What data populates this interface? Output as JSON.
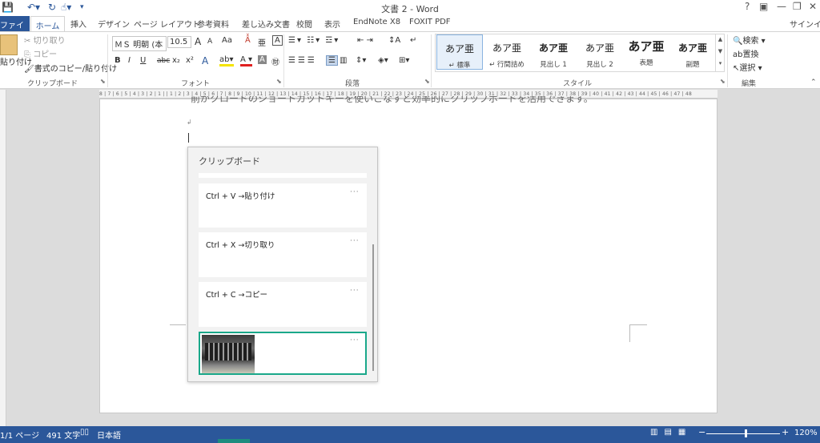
{
  "app": {
    "title": "文書 2 - Word",
    "help": "?",
    "signin": "サインイン"
  },
  "tabs": {
    "file": "ファイル",
    "home": "ホーム",
    "insert": "挿入",
    "design": "デザイン",
    "layout": "ページ レイアウト",
    "references": "参考資料",
    "mailings": "差し込み文書",
    "review": "校閲",
    "view": "表示",
    "endnote": "EndNote X8",
    "foxit": "FOXIT PDF"
  },
  "ribbon": {
    "clipboard": {
      "paste": "貼り付け",
      "cut": "切り取り",
      "copy": "コピー",
      "format_painter": "書式のコピー/貼り付け",
      "label": "クリップボード"
    },
    "font": {
      "name": "ＭＳ 明朝 (本",
      "size": "10.5",
      "grow": "A",
      "shrink": "A",
      "case": "Aa",
      "label": "フォント",
      "bold": "B",
      "italic": "I",
      "underline": "U",
      "strike": "abc",
      "sub": "x₂",
      "sup": "x²"
    },
    "paragraph": {
      "label": "段落"
    },
    "styles": {
      "label": "スタイル",
      "items": [
        {
          "preview": "あア亜",
          "name": "↵ 標準"
        },
        {
          "preview": "あア亜",
          "name": "↵ 行間詰め"
        },
        {
          "preview": "あア亜",
          "name": "見出し 1"
        },
        {
          "preview": "あア亜",
          "name": "見出し 2"
        },
        {
          "preview": "あア亜",
          "name": "表題"
        },
        {
          "preview": "あア亜",
          "name": "副題"
        }
      ]
    },
    "editing": {
      "find": "検索",
      "replace": "置換",
      "select": "選択",
      "label": "編集"
    }
  },
  "ruler": {
    "ticks": "8 | 7 | 6 | 5 | 4 | 3 | 2 | 1 |   | 1 | 2 | 3 | 4 | 5 | 6 | 7 | 8 | 9 | 10 | 11 | 12 | 13 | 14 | 15 | 16 | 17 | 18 | 19 | 20 | 21 | 22 | 23 | 24 | 25 | 26 | 27 | 28 | 29 | 30 | 31 | 32 | 33 | 34 | 35 | 36 | 37 | 38 | 39 | 40 | 41 | 42 | 43 | 44 | 45 | 46 | 47 | 48"
  },
  "document": {
    "partial_line": "前がクロードのショートカットキーを使いこなすと効率的にクリップボードを活用できます。"
  },
  "clipboard_panel": {
    "title": "クリップボード",
    "more": "···",
    "items": [
      {
        "text": "Ctrl + V →貼り付け"
      },
      {
        "text": "Ctrl + X →切り取り"
      },
      {
        "text": "Ctrl + C →コピー"
      },
      {
        "text": ""
      }
    ]
  },
  "status": {
    "page": "1/1 ページ",
    "words": "491 文字",
    "language": "日本語",
    "zoom": "120%"
  }
}
